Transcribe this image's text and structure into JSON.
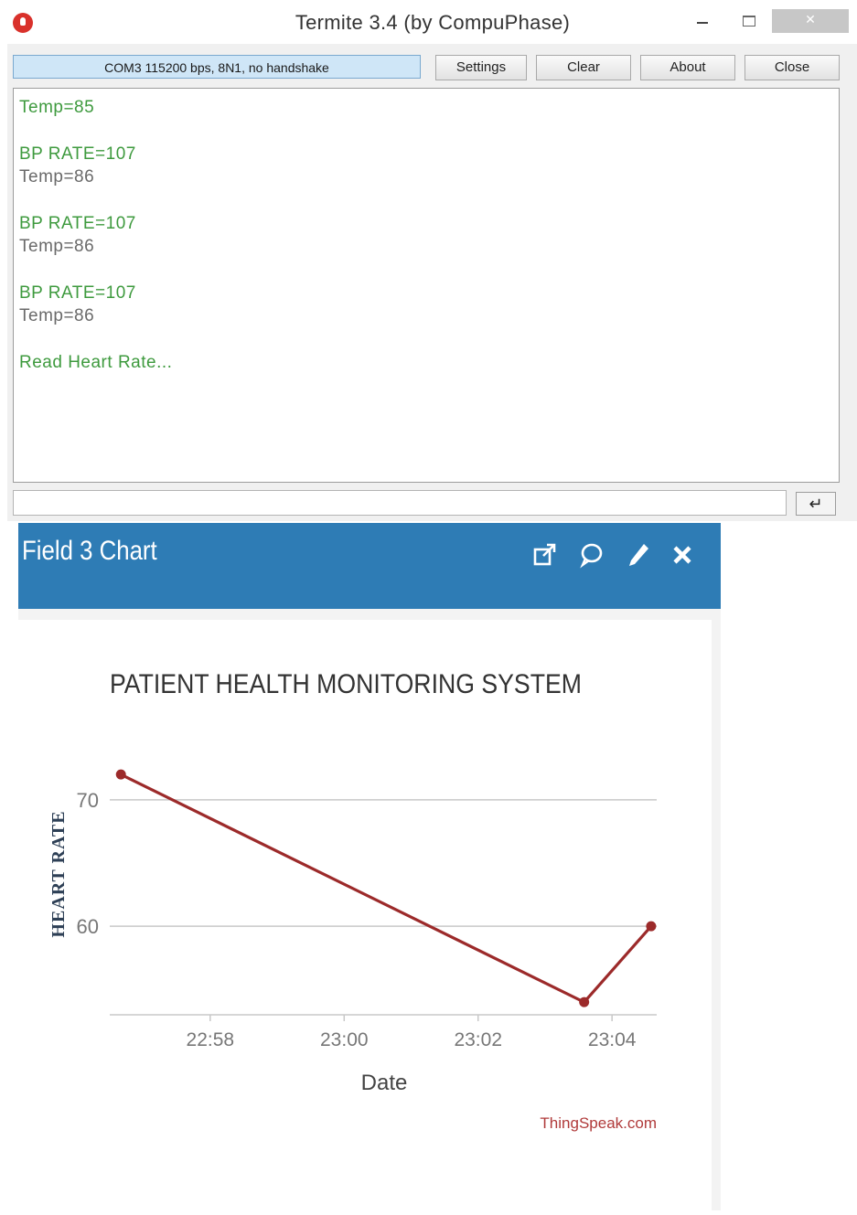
{
  "termite": {
    "title": "Termite 3.4 (by CompuPhase)",
    "port_status": "COM3 115200 bps, 8N1, no handshake",
    "buttons": {
      "settings": "Settings",
      "clear": "Clear",
      "about": "About",
      "close": "Close"
    },
    "terminal_lines": [
      "Temp=85",
      "BP RATE=107",
      "Temp=86",
      "BP RATE=107",
      "Temp=86",
      "BP RATE=107",
      "Temp=86",
      "Read Heart Rate..."
    ],
    "input_value": "",
    "send_icon": "enter-arrow-icon"
  },
  "panel": {
    "title": "Field 3 Chart",
    "icons": [
      "external-link-icon",
      "comment-icon",
      "pencil-icon",
      "close-icon"
    ],
    "header_color": "#2e7cb5"
  },
  "chart_data": {
    "type": "line",
    "title": "PATIENT HEALTH MONITORING SYSTEM",
    "xlabel": "Date",
    "ylabel": "HEART RATE",
    "x_ticks": [
      "22:58",
      "23:00",
      "23:02",
      "23:04"
    ],
    "y_ticks": [
      60,
      70
    ],
    "series": [
      {
        "x": [
          "22:56:40",
          "23:03:35",
          "23:04:35"
        ],
        "values": [
          72,
          54,
          60
        ],
        "color": "#9c2a2a"
      }
    ],
    "xlim": [
      "22:56:30",
      "23:04:40"
    ],
    "ylim": [
      53,
      77
    ],
    "grid": true,
    "credit": "ThingSpeak.com"
  }
}
